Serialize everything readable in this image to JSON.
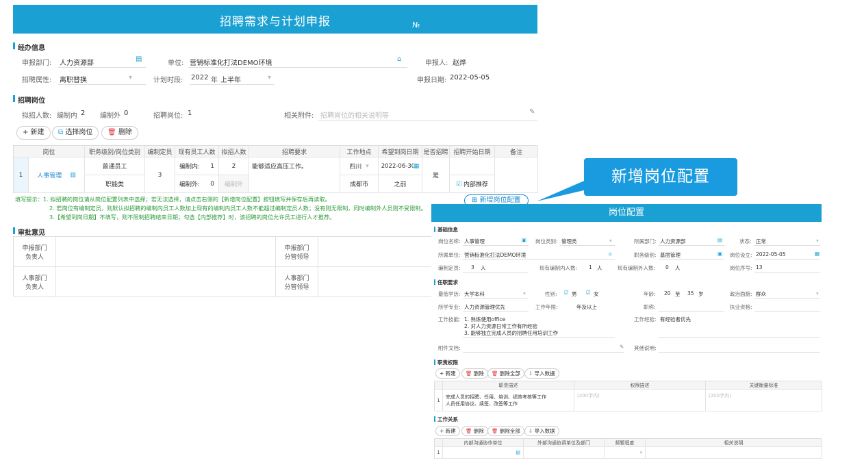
{
  "main": {
    "title": "招聘需求与计划申报",
    "no_label": "№",
    "sections": {
      "handler": "经办信息",
      "positions": "招聘岗位",
      "approval": "审批意见"
    },
    "handler": {
      "dept_label": "申报部门:",
      "dept_value": "人力资源部",
      "unit_label": "单位:",
      "unit_value": "营销标准化打法DEMO环境",
      "applicant_label": "申报人:",
      "applicant_value": "赵烨",
      "attr_label": "招聘属性:",
      "attr_value": "离职替换",
      "period_label": "计划时段:",
      "period_year": "2022",
      "period_year_unit": "年",
      "period_half": "上半年",
      "date_label": "申报日期:",
      "date_value": "2022-05-05"
    },
    "stats": {
      "planned_label": "拟招人数:",
      "in_quota_label": "编制内",
      "in_quota_value": "2",
      "out_quota_label": "编制外",
      "out_quota_value": "0",
      "posts_label": "招聘岗位:",
      "posts_value": "1",
      "attach_label": "相关附件:",
      "attach_placeholder": "招聘岗位的相关说明等"
    },
    "toolbar": {
      "new": "+ 新建",
      "select": "选择岗位",
      "delete": "删除"
    },
    "table": {
      "headers": [
        "岗位",
        "职务级别/岗位类别",
        "编制定员",
        "现有员工人数",
        "拟招人数",
        "招聘要求",
        "工作地点",
        "希望到岗日期",
        "是否招聘",
        "招聘开始日期",
        "备注"
      ],
      "row": {
        "index": "1",
        "post": "人事管理",
        "level": "普通员工",
        "category": "职能类",
        "quota": "3",
        "in_label": "编制内:",
        "in_current": "1",
        "in_planned": "2",
        "out_label": "编制外:",
        "out_current": "0",
        "out_planned": "编制外",
        "requirement": "能够适应高压工作。",
        "province": "四川",
        "city": "成都市",
        "date": "2022-06-30",
        "before": "之前",
        "recruit": "是",
        "internal": "内部推荐"
      }
    },
    "tips": {
      "line1": "填写提示：1. 拟招聘的岗位请从岗位配置列表中选择；若无法选择，请点击右侧的【新增岗位配置】按钮填写并保存后再读取。",
      "line2": "2. 若岗位有编制定员，则默认拟招聘的编制内员工人数加上现有的编制内员工人数不能超过编制定员人数；没有则无限制，同时编制外人员则不受限制。",
      "line3": "3.【希望到岗日期】不填写，则不限制招聘结束日期；勾选【内部推荐】时，该招聘的岗位允许员工进行人才推荐。",
      "add_config_button": "新增岗位配置"
    },
    "approval": {
      "rows": [
        {
          "left": "申报部门\n负责人",
          "right": "申报部门\n分管领导"
        },
        {
          "left": "人事部门\n负责人",
          "right": "人事部门\n分管领导"
        }
      ]
    }
  },
  "callout": "新增岗位配置",
  "config": {
    "title": "岗位配置",
    "sections": {
      "basic": "基础信息",
      "requirements": "任职要求",
      "duties": "职责权限",
      "relations": "工作关系"
    },
    "basic": {
      "name_label": "岗位名称:",
      "name_value": "人事管理",
      "type_label": "岗位类别:",
      "type_value": "管理类",
      "dept_label": "所属部门:",
      "dept_value": "人力资源部",
      "status_label": "状态:",
      "status_value": "正常",
      "unit_label": "所属单位:",
      "unit_value": "营销标准化打法DEMO环境",
      "level_label": "职务级别:",
      "level_value": "基层管理",
      "setdate_label": "岗位设立:",
      "setdate_value": "2022-05-05",
      "quota_label": "编制定员:",
      "quota_value": "3",
      "quota_unit": "人",
      "current_in_label": "现有编制内人数:",
      "current_in_value": "1",
      "current_in_unit": "人",
      "current_out_label": "现有编制外人数:",
      "current_out_value": "0",
      "current_out_unit": "人",
      "seq_label": "岗位序号:",
      "seq_value": "13"
    },
    "req": {
      "edu_label": "最低学历:",
      "edu_value": "大学本科",
      "gender_label": "性别:",
      "male": "男",
      "female": "女",
      "age_label": "年龄:",
      "age_from": "20",
      "age_to_word": "至",
      "age_to": "35",
      "age_unit": "岁",
      "politics_label": "政治面貌:",
      "politics_value": "群众",
      "major_label": "所学专业:",
      "major_value": "人力资源管理优先",
      "years_label": "工作年限:",
      "years_value": "年及以上",
      "title_label": "职称:",
      "cert_label": "执业资格:",
      "skills_label": "工作技能:",
      "skills": [
        "1. 熟练使用office",
        "2. 对人力资源日常工作有所经验",
        "3. 能够独立完成人员的招聘任用培训工作"
      ],
      "exp_label": "工作经验:",
      "exp_value": "有经验者优先",
      "attach_label": "附件文档:",
      "other_label": "其他说明:"
    },
    "duties": {
      "buttons": [
        "+ 新建",
        "删除",
        "删除全部",
        "导入数据"
      ],
      "headers": [
        "职责描述",
        "权限描述",
        "关键衡量标准"
      ],
      "row_index": "1",
      "desc": [
        "完成人员的招聘、任用、培训、绩效考核等工作",
        "人员任用协议、续签、改签等工作"
      ],
      "ph1": "(200字内)",
      "ph2": "(200字内)"
    },
    "relations": {
      "buttons": [
        "+ 新建",
        "删除",
        "删除全部",
        "导入数据"
      ],
      "headers": [
        "内部沟通协作单位",
        "外部沟通协调单位及部门",
        "频繁程度",
        "相关说明"
      ],
      "row_index": "1"
    }
  }
}
